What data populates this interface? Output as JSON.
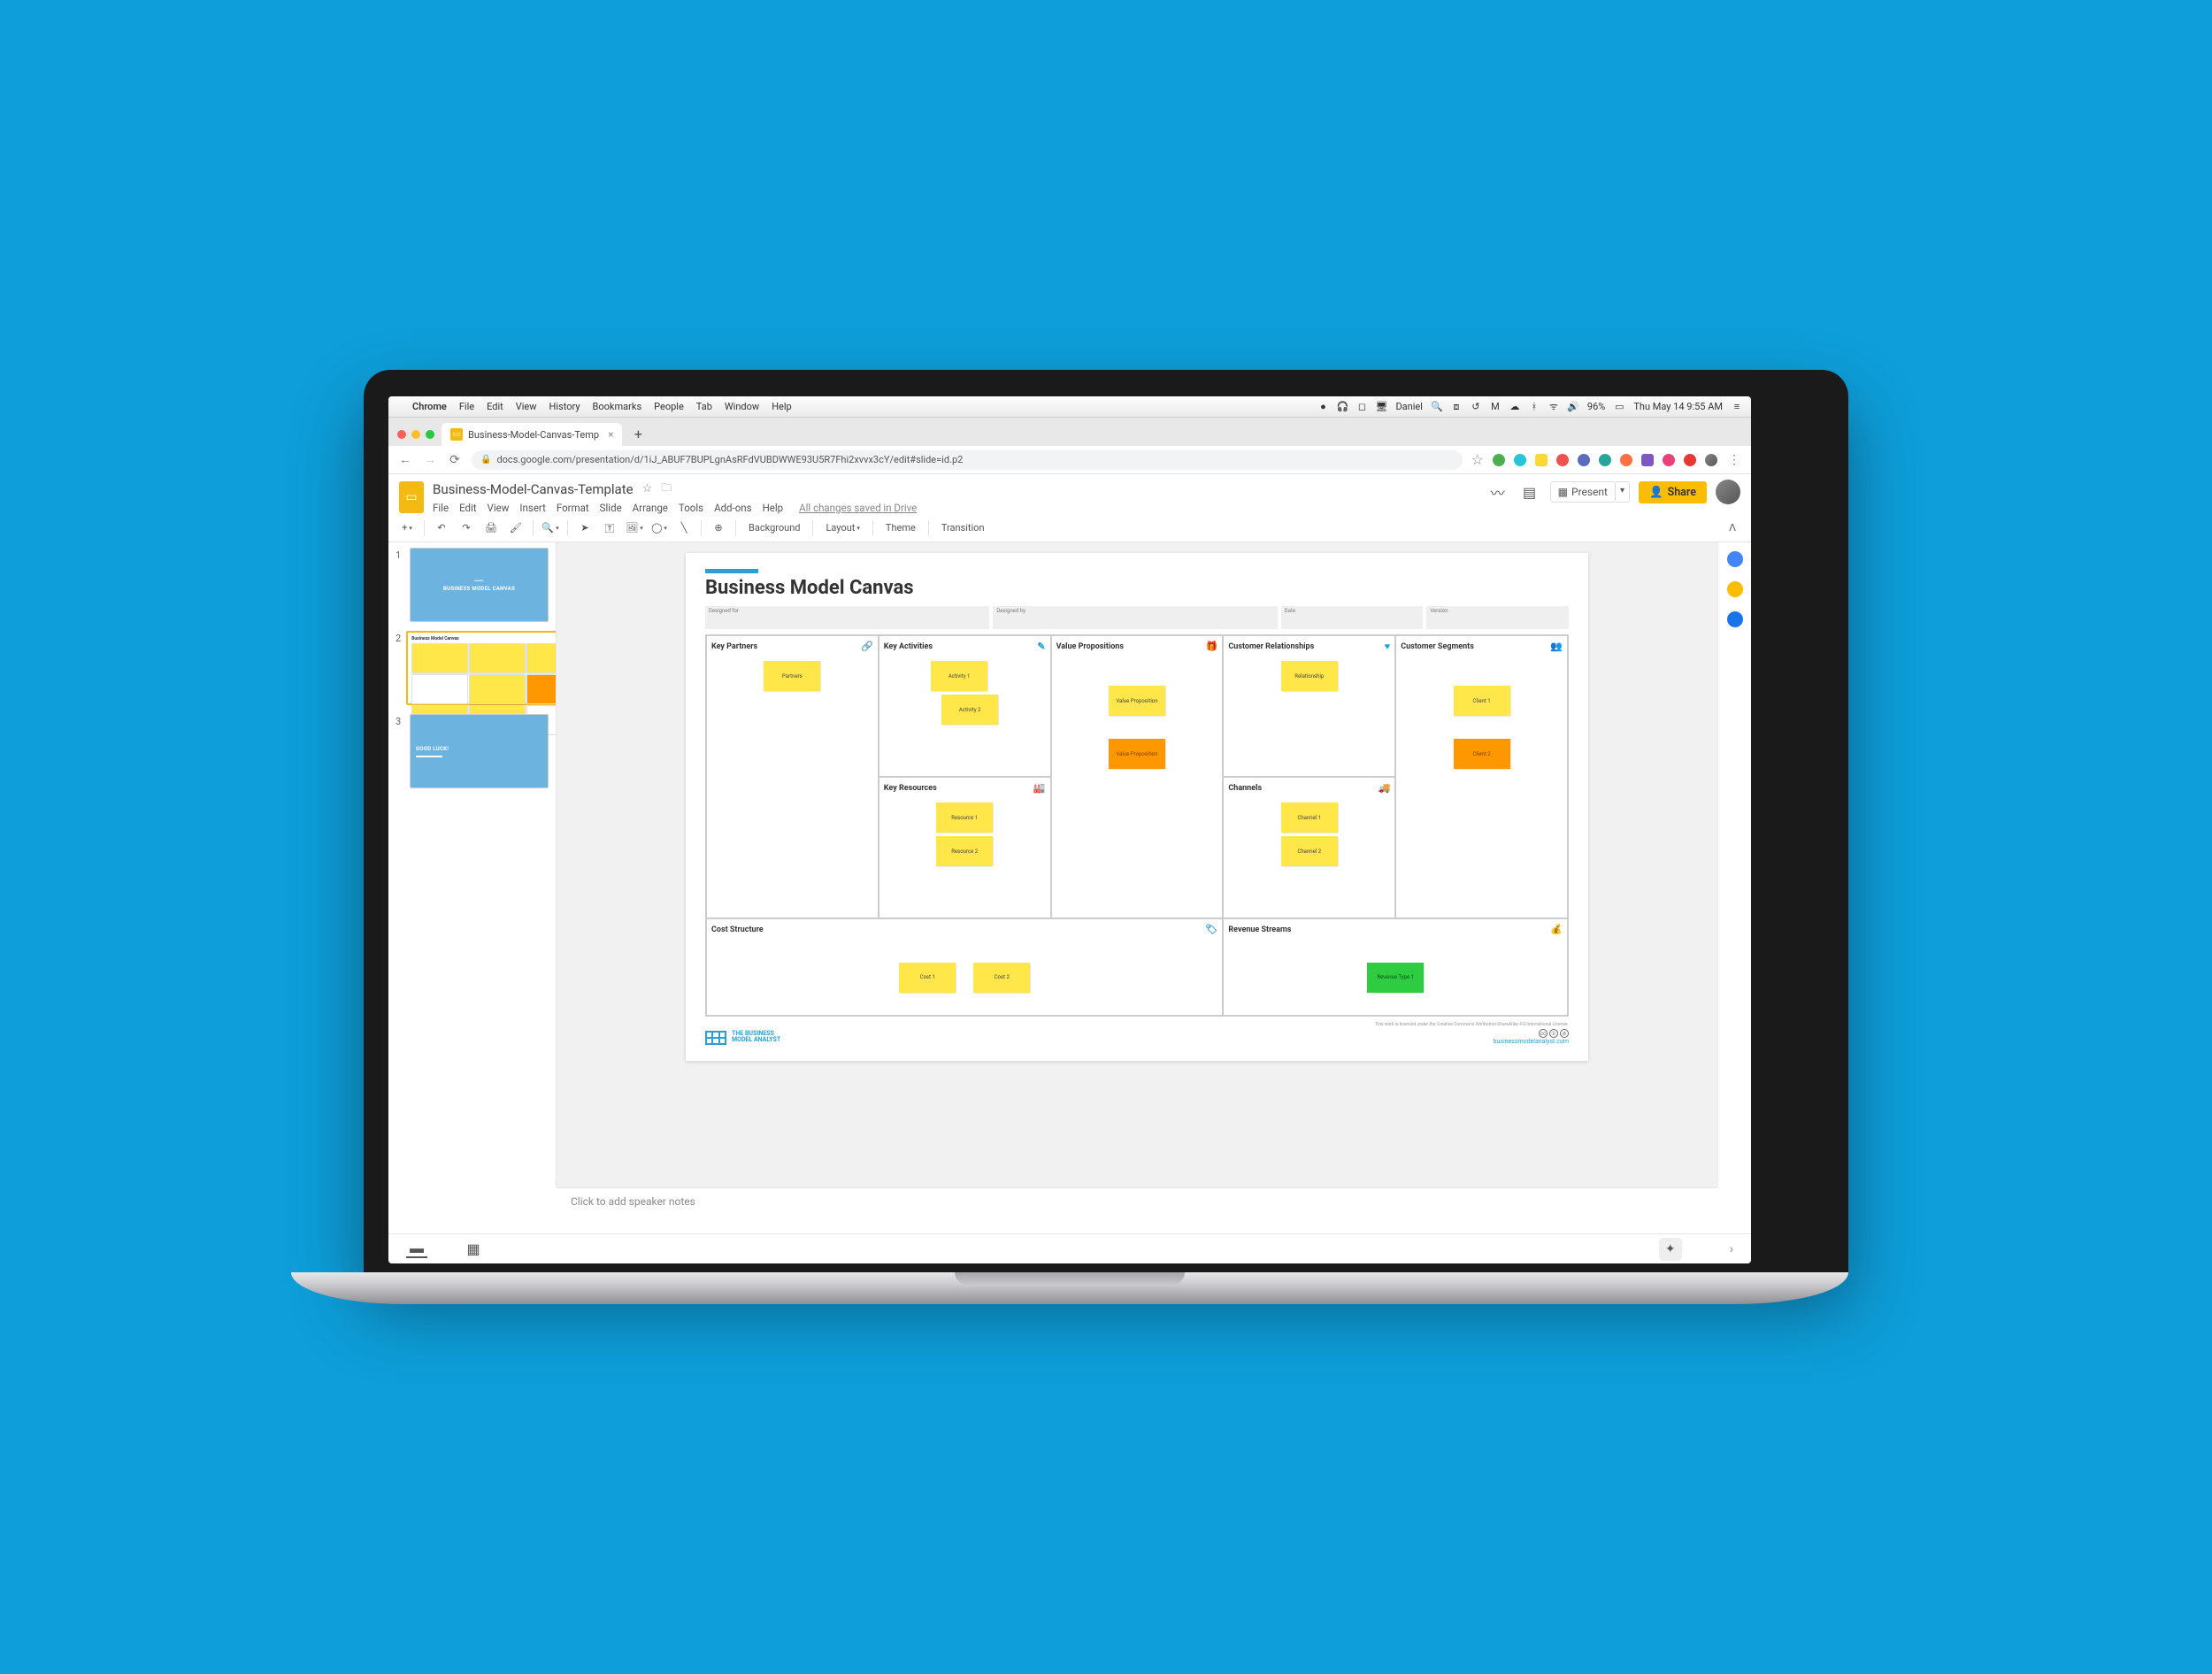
{
  "mac_menubar": {
    "app": "Chrome",
    "items": [
      "File",
      "Edit",
      "View",
      "History",
      "Bookmarks",
      "People",
      "Tab",
      "Window",
      "Help"
    ],
    "status_user": "Daniel",
    "battery": "96%",
    "datetime": "Thu May 14  9:55 AM"
  },
  "browser": {
    "tab_title": "Business-Model-Canvas-Temp",
    "url": "docs.google.com/presentation/d/1iJ_ABUF7BUPLgnAsRFdVUBDWWE93U5R7Fhi2xvvx3cY/edit#slide=id.p2"
  },
  "app": {
    "title": "Business-Model-Canvas-Template",
    "menus": [
      "File",
      "Edit",
      "View",
      "Insert",
      "Format",
      "Slide",
      "Arrange",
      "Tools",
      "Add-ons",
      "Help"
    ],
    "saved_msg": "All changes saved in Drive",
    "present": "Present",
    "share": "Share",
    "toolbar": {
      "background": "Background",
      "layout": "Layout",
      "theme": "Theme",
      "transition": "Transition"
    },
    "thumbs": [
      {
        "num": "1",
        "label": "BUSINESS MODEL CANVAS",
        "type": "title"
      },
      {
        "num": "2",
        "label": "Business Model Canvas",
        "type": "canvas"
      },
      {
        "num": "3",
        "label": "GOOD LUCK!",
        "type": "end"
      }
    ],
    "notes_placeholder": "Click to add speaker notes"
  },
  "slide": {
    "title": "Business Model Canvas",
    "meta": {
      "designed_for": "Designed for",
      "designed_by": "Designed by",
      "date": "Date",
      "version": "Version"
    },
    "boxes": {
      "kp": {
        "title": "Key Partners",
        "icon": "🔗",
        "notes": [
          {
            "t": "Partners",
            "c": "y"
          }
        ]
      },
      "ka": {
        "title": "Key Activities",
        "icon": "✎",
        "notes": [
          {
            "t": "Activity 1",
            "c": "y"
          },
          {
            "t": "Activity 2",
            "c": "y"
          }
        ]
      },
      "kr": {
        "title": "Key Resources",
        "icon": "🏭",
        "notes": [
          {
            "t": "Resource 1",
            "c": "y"
          },
          {
            "t": "Resource 2",
            "c": "y"
          }
        ]
      },
      "vp": {
        "title": "Value Propositions",
        "icon": "🎁",
        "notes": [
          {
            "t": "Value Proposition",
            "c": "y"
          },
          {
            "t": "Value Proposition",
            "c": "o"
          }
        ]
      },
      "cr": {
        "title": "Customer Relationships",
        "icon": "♥",
        "notes": [
          {
            "t": "Relationship",
            "c": "y"
          }
        ]
      },
      "ch": {
        "title": "Channels",
        "icon": "🚚",
        "notes": [
          {
            "t": "Channel 1",
            "c": "y"
          },
          {
            "t": "Channel 2",
            "c": "y"
          }
        ]
      },
      "cs": {
        "title": "Customer Segments",
        "icon": "👥",
        "notes": [
          {
            "t": "Client 1",
            "c": "y"
          },
          {
            "t": "Client 2",
            "c": "o"
          }
        ]
      },
      "cost": {
        "title": "Cost Structure",
        "icon": "🏷",
        "notes": [
          {
            "t": "Cost 1",
            "c": "y"
          },
          {
            "t": "Cost 2",
            "c": "y"
          }
        ]
      },
      "rev": {
        "title": "Revenue Streams",
        "icon": "💰",
        "notes": [
          {
            "t": "Revenue Type 1",
            "c": "g"
          }
        ]
      }
    },
    "brand": {
      "line1": "THE BUSINESS",
      "line2": "MODEL ANALYST",
      "url": "businessmodelanalyst.com",
      "license": "This work is licensed under the Creative Commons Attribution-ShareAlike 4.0 International License."
    }
  }
}
